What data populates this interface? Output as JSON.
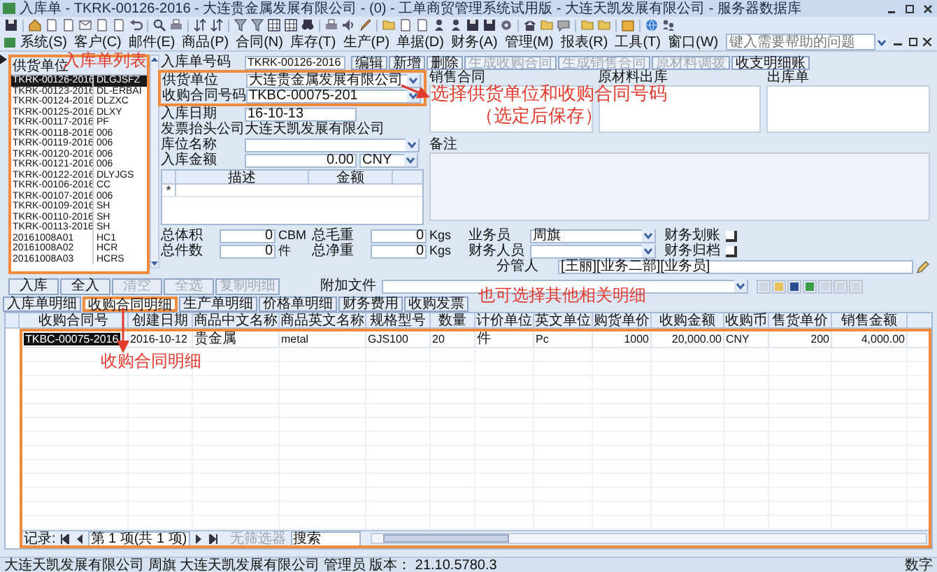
{
  "window": {
    "title": "入库单 - TKRK-00126-2016 - 大连贵金属发展有限公司 - (0) - 工单商贸管理系统试用版 - 大连天凯发展有限公司 - 服务器数据库"
  },
  "menu": [
    "系统(S)",
    "客户(C)",
    "邮件(E)",
    "商品(P)",
    "合同(N)",
    "库存(T)",
    "生产(P)",
    "单据(D)",
    "财务(A)",
    "管理(M)",
    "报表(R)",
    "工具(T)",
    "窗口(W)"
  ],
  "help_search": {
    "placeholder": "键入需要帮助的问题"
  },
  "list": {
    "header": "供货单位",
    "rows": [
      {
        "number": "TKRK-00126-2016",
        "code": "DLGJSFZ",
        "selected": true
      },
      {
        "number": "TKRK-00123-2016",
        "code": "DL-ERBAI",
        "selected": false
      },
      {
        "number": "TKRK-00124-2016",
        "code": "DLZXC",
        "selected": false
      },
      {
        "number": "TKRK-00125-2016",
        "code": "DLXY",
        "selected": false
      },
      {
        "number": "TKRK-00117-2016",
        "code": "PF",
        "selected": false
      },
      {
        "number": "TKRK-00118-2016",
        "code": "006",
        "selected": false
      },
      {
        "number": "TKRK-00119-2016",
        "code": "006",
        "selected": false
      },
      {
        "number": "TKRK-00120-2016",
        "code": "006",
        "selected": false
      },
      {
        "number": "TKRK-00121-2016",
        "code": "006",
        "selected": false
      },
      {
        "number": "TKRK-00122-2016",
        "code": "DLYJGS",
        "selected": false
      },
      {
        "number": "TKRK-00106-2016",
        "code": "CC",
        "selected": false
      },
      {
        "number": "TKRK-00107-2016",
        "code": "006",
        "selected": false
      },
      {
        "number": "TKRK-00109-2016",
        "code": "SH",
        "selected": false
      },
      {
        "number": "TKRK-00110-2016",
        "code": "SH",
        "selected": false
      },
      {
        "number": "TKRK-00113-2016",
        "code": "SH",
        "selected": false
      },
      {
        "number": "20161008A01",
        "code": "HC1",
        "selected": false
      },
      {
        "number": "20161008A02",
        "code": "HCR",
        "selected": false
      },
      {
        "number": "20161008A03",
        "code": "HCRS",
        "selected": false
      }
    ]
  },
  "receipt": {
    "label": "入库单号码",
    "value": "TKRK-00126-2016"
  },
  "actions": [
    {
      "label": "编辑",
      "disabled": false
    },
    {
      "label": "新增",
      "disabled": false
    },
    {
      "label": "删除",
      "disabled": false
    },
    {
      "label": "生成收购合同",
      "disabled": true
    },
    {
      "label": "生成销售合同",
      "disabled": true
    },
    {
      "label": "原材料调拨",
      "disabled": true
    },
    {
      "label": "收支明细账",
      "disabled": false
    }
  ],
  "fields": [
    {
      "label": "供货单位",
      "value": "大连贵金属发展有限公司",
      "kind": "select"
    },
    {
      "label": "收购合同号码",
      "value": "TKBC-00075-201",
      "kind": "select"
    },
    {
      "label": "入库日期",
      "value": "16-10-13",
      "kind": "text"
    },
    {
      "label": "发票抬头公司",
      "value": "大连天凯发展有限公司",
      "kind": "plain"
    },
    {
      "label": "库位名称",
      "kind": "select"
    },
    {
      "label": "入库金额",
      "value": "0.00",
      "currency": "CNY",
      "kind": "amount"
    }
  ],
  "mini_grid": {
    "columns": [
      "描述",
      "金额"
    ],
    "new_row": "*"
  },
  "linked_docs": [
    "销售合同",
    "原材料出库",
    "出库单"
  ],
  "remarks": {
    "label": "备注"
  },
  "totals": [
    {
      "label": "总体积",
      "value": "0",
      "unit": "CBM"
    },
    {
      "label": "总毛重",
      "value": "0",
      "unit": "Kgs"
    },
    {
      "label": "总件数",
      "value": "0",
      "unit": "件"
    },
    {
      "label": "总净重",
      "value": "0",
      "unit": "Kgs"
    }
  ],
  "staff": [
    {
      "label": "业务员",
      "value": "周旗"
    },
    {
      "label": "财务人员"
    }
  ],
  "checks": [
    {
      "label": "财务划账",
      "checked": false
    },
    {
      "label": "财务归档",
      "checked": false
    }
  ],
  "manager": {
    "label": "分管人",
    "value": "[王丽][业务二部][业务员]"
  },
  "attachments": {
    "label": "附加文件"
  },
  "detail_buttons": [
    {
      "label": "入库",
      "disabled": false
    },
    {
      "label": "全入",
      "disabled": false
    },
    {
      "label": "清空",
      "disabled": true
    },
    {
      "label": "全选",
      "disabled": true
    },
    {
      "label": "复制明细",
      "disabled": true
    }
  ],
  "detail_tabs": [
    {
      "label": "入库单明细",
      "selected": false
    },
    {
      "label": "收购合同明细",
      "selected": true
    },
    {
      "label": "生产单明细",
      "selected": false
    },
    {
      "label": "价格单明细",
      "selected": false
    },
    {
      "label": "财务费用",
      "selected": false
    },
    {
      "label": "收购发票",
      "selected": false
    }
  ],
  "grid": {
    "columns": [
      "收购合同号",
      "创建日期",
      "商品中文名称",
      "商品英文名称",
      "规格型号",
      "数量",
      "计价单位",
      "英文单位",
      "购货单价",
      "收购金额",
      "收购币",
      "售货单价",
      "销售金额"
    ],
    "rows": [
      {
        "cells": [
          "TKBC-00075-2016",
          "2016-10-12",
          "贵金属",
          "metal",
          "GJS100",
          "20",
          "件",
          "Pc",
          "1000",
          "20,000.00",
          "CNY",
          "200",
          "4,000.00"
        ],
        "selected": true
      }
    ]
  },
  "pager": {
    "label": "记录:",
    "position": "第 1 项(共 1 项)",
    "filter": "无筛选器",
    "search": "搜索"
  },
  "status_bar": {
    "text": "大连天凯发展有限公司 周旗 大连天凯发展有限公司 管理员 版本： 21.10.5780.3",
    "mode": "数字"
  },
  "annotations": [
    {
      "text": "入库单列表"
    },
    {
      "text": "选择供货单位和收购合同号码"
    },
    {
      "text": "（选定后保存）"
    },
    {
      "text": "也可选择其他相关明细"
    },
    {
      "text": "收购合同明细"
    }
  ]
}
